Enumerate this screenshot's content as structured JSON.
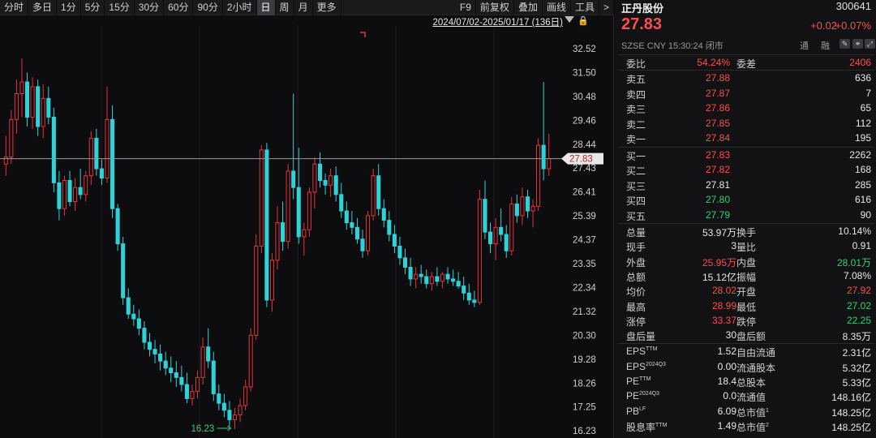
{
  "toolbar": {
    "left": [
      "分时",
      "多日",
      "1分",
      "5分",
      "15分",
      "30分",
      "60分",
      "90分",
      "2小时",
      "日",
      "周",
      "月",
      "更多"
    ],
    "active": "日",
    "right": [
      "F9",
      "前复权",
      "叠加",
      "画线",
      "工具",
      ">"
    ]
  },
  "chart": {
    "range": "2024/07/02-2025/01/17 (136日)",
    "price_labels": [
      "32.52",
      "31.50",
      "30.48",
      "29.46",
      "28.44",
      "27.43",
      "26.41",
      "25.39",
      "24.37",
      "23.35",
      "22.34",
      "21.32",
      "20.30",
      "19.28",
      "18.26",
      "17.25",
      "16.23"
    ],
    "current_price_tag": "27.83",
    "low_marker": "16.23",
    "colors": {
      "up": "#e8323c",
      "down": "#2ed3d8",
      "tag_bg": "#e8e8e8",
      "tag_fg": "#c81e28",
      "low": "#2fd17a"
    }
  },
  "chart_data": {
    "type": "candlestick",
    "ylim": [
      16.23,
      32.52
    ],
    "ohlc": [
      [
        27.6,
        28.8,
        27.1,
        27.9
      ],
      [
        27.9,
        29.9,
        27.6,
        29.5
      ],
      [
        29.5,
        31.2,
        28.9,
        30.6
      ],
      [
        30.6,
        32.1,
        29.6,
        31.1
      ],
      [
        31.1,
        31.5,
        29.2,
        29.6
      ],
      [
        29.6,
        31.3,
        29.1,
        30.9
      ],
      [
        30.9,
        31.2,
        28.8,
        29.2
      ],
      [
        29.2,
        31.0,
        28.7,
        30.4
      ],
      [
        30.4,
        30.9,
        29.3,
        29.6
      ],
      [
        29.6,
        30.0,
        26.4,
        26.8
      ],
      [
        26.8,
        27.3,
        25.2,
        25.7
      ],
      [
        25.7,
        27.1,
        25.4,
        26.9
      ],
      [
        26.9,
        27.3,
        25.8,
        26.0
      ],
      [
        26.0,
        27.0,
        25.6,
        26.6
      ],
      [
        26.6,
        27.4,
        26.1,
        26.3
      ],
      [
        26.3,
        27.3,
        26.0,
        27.1
      ],
      [
        27.1,
        29.0,
        26.7,
        28.7
      ],
      [
        28.7,
        29.1,
        27.1,
        27.4
      ],
      [
        27.4,
        27.8,
        26.7,
        27.0
      ],
      [
        27.0,
        30.9,
        26.8,
        29.5
      ],
      [
        29.5,
        30.1,
        25.3,
        25.7
      ],
      [
        25.7,
        25.9,
        23.9,
        24.2
      ],
      [
        24.2,
        24.5,
        21.6,
        21.9
      ],
      [
        21.9,
        22.3,
        21.0,
        21.2
      ],
      [
        21.2,
        21.6,
        20.7,
        21.0
      ],
      [
        21.0,
        21.4,
        20.3,
        20.6
      ],
      [
        20.6,
        20.9,
        19.7,
        20.0
      ],
      [
        20.0,
        20.4,
        19.4,
        19.7
      ],
      [
        19.7,
        20.1,
        19.1,
        19.5
      ],
      [
        19.5,
        19.9,
        18.8,
        19.2
      ],
      [
        19.2,
        19.6,
        18.6,
        18.9
      ],
      [
        18.9,
        19.4,
        18.3,
        18.7
      ],
      [
        18.7,
        19.2,
        18.1,
        18.5
      ],
      [
        18.5,
        19.0,
        17.9,
        18.2
      ],
      [
        18.2,
        18.7,
        17.4,
        17.6
      ],
      [
        17.6,
        18.2,
        17.3,
        17.9
      ],
      [
        17.9,
        18.8,
        17.6,
        18.5
      ],
      [
        18.5,
        20.2,
        18.2,
        19.8
      ],
      [
        19.8,
        20.6,
        18.9,
        19.2
      ],
      [
        19.2,
        19.6,
        17.5,
        17.8
      ],
      [
        17.8,
        18.2,
        17.1,
        17.4
      ],
      [
        17.4,
        17.8,
        16.8,
        17.1
      ],
      [
        17.1,
        17.5,
        16.4,
        16.7
      ],
      [
        16.7,
        17.2,
        16.3,
        16.9
      ],
      [
        16.9,
        17.6,
        16.6,
        17.3
      ],
      [
        17.3,
        18.4,
        17.1,
        18.1
      ],
      [
        18.1,
        20.6,
        17.9,
        20.3
      ],
      [
        20.3,
        24.6,
        20.1,
        24.1
      ],
      [
        24.1,
        28.4,
        23.8,
        28.2
      ],
      [
        28.2,
        28.5,
        21.5,
        21.8
      ],
      [
        21.8,
        23.8,
        21.3,
        23.5
      ],
      [
        23.5,
        25.8,
        23.1,
        25.1
      ],
      [
        25.1,
        26.0,
        23.9,
        24.3
      ],
      [
        24.3,
        27.6,
        24.0,
        27.3
      ],
      [
        27.3,
        30.6,
        26.1,
        26.6
      ],
      [
        26.6,
        28.3,
        24.2,
        24.5
      ],
      [
        24.5,
        25.1,
        23.7,
        24.8
      ],
      [
        24.8,
        26.6,
        24.5,
        26.4
      ],
      [
        26.4,
        27.9,
        25.7,
        27.6
      ],
      [
        27.6,
        28.1,
        26.6,
        26.9
      ],
      [
        26.9,
        27.2,
        26.3,
        26.7
      ],
      [
        26.7,
        27.4,
        26.2,
        27.1
      ],
      [
        27.1,
        27.5,
        26.0,
        26.3
      ],
      [
        26.3,
        26.8,
        25.3,
        25.6
      ],
      [
        25.6,
        26.0,
        24.8,
        25.1
      ],
      [
        25.1,
        25.6,
        24.6,
        24.9
      ],
      [
        24.9,
        25.3,
        24.2,
        24.4
      ],
      [
        24.4,
        24.8,
        23.6,
        23.9
      ],
      [
        23.9,
        25.6,
        23.7,
        25.4
      ],
      [
        25.4,
        27.4,
        25.2,
        27.1
      ],
      [
        27.1,
        27.6,
        25.4,
        25.7
      ],
      [
        25.7,
        26.1,
        24.9,
        25.2
      ],
      [
        25.2,
        25.6,
        24.3,
        24.6
      ],
      [
        24.6,
        25.0,
        23.8,
        24.1
      ],
      [
        24.1,
        24.5,
        23.3,
        23.6
      ],
      [
        23.6,
        24.0,
        22.9,
        23.2
      ],
      [
        23.2,
        23.6,
        22.4,
        22.7
      ],
      [
        22.7,
        23.2,
        22.3,
        22.9
      ],
      [
        22.9,
        23.3,
        22.5,
        22.8
      ],
      [
        22.8,
        23.1,
        22.3,
        22.5
      ],
      [
        22.5,
        23.0,
        22.2,
        22.8
      ],
      [
        22.8,
        23.2,
        22.4,
        22.6
      ],
      [
        22.6,
        23.0,
        22.3,
        22.9
      ],
      [
        22.9,
        23.2,
        22.5,
        22.7
      ],
      [
        22.7,
        23.1,
        22.4,
        22.6
      ],
      [
        22.6,
        23.0,
        22.3,
        22.4
      ],
      [
        22.4,
        22.8,
        21.8,
        22.1
      ],
      [
        22.1,
        22.5,
        21.6,
        21.8
      ],
      [
        21.8,
        22.2,
        21.5,
        21.7
      ],
      [
        21.7,
        26.5,
        21.6,
        26.1
      ],
      [
        26.1,
        26.9,
        24.4,
        24.7
      ],
      [
        24.7,
        25.1,
        23.8,
        24.2
      ],
      [
        24.2,
        25.3,
        23.5,
        24.9
      ],
      [
        24.9,
        25.7,
        24.3,
        24.6
      ],
      [
        24.6,
        25.0,
        23.6,
        23.9
      ],
      [
        23.9,
        26.2,
        23.7,
        25.9
      ],
      [
        25.9,
        26.3,
        25.1,
        25.4
      ],
      [
        25.4,
        26.6,
        25.0,
        26.2
      ],
      [
        26.2,
        26.5,
        25.3,
        25.6
      ],
      [
        25.6,
        26.1,
        24.9,
        25.8
      ],
      [
        25.8,
        28.7,
        25.6,
        28.4
      ],
      [
        28.4,
        31.1,
        26.9,
        27.4
      ],
      [
        27.4,
        28.9,
        27.1,
        27.83
      ]
    ]
  },
  "panel": {
    "name": "正丹股份",
    "code": "300641",
    "price": "27.83",
    "change": "+0.02",
    "change_pct": "+0.07%",
    "meta": "SZSE  CNY  15:30:24  闭市",
    "tong": "通",
    "rong": "融",
    "weibi": {
      "label": "委比",
      "value": "54.24%",
      "label2": "委差",
      "value2": "2406"
    },
    "asks": [
      {
        "label": "卖五",
        "price": "27.88",
        "vol": "636"
      },
      {
        "label": "卖四",
        "price": "27.87",
        "vol": "7"
      },
      {
        "label": "卖三",
        "price": "27.86",
        "vol": "65"
      },
      {
        "label": "卖二",
        "price": "27.85",
        "vol": "112"
      },
      {
        "label": "卖一",
        "price": "27.84",
        "vol": "195"
      }
    ],
    "bids": [
      {
        "label": "买一",
        "price": "27.83",
        "vol": "2262",
        "color": "red"
      },
      {
        "label": "买二",
        "price": "27.82",
        "vol": "168",
        "color": "red"
      },
      {
        "label": "买三",
        "price": "27.81",
        "vol": "285",
        "color": "white"
      },
      {
        "label": "买四",
        "price": "27.80",
        "vol": "616",
        "color": "green"
      },
      {
        "label": "买五",
        "price": "27.79",
        "vol": "90",
        "color": "green"
      }
    ],
    "stats": [
      {
        "l1": "总量",
        "v1": "53.97万",
        "c1": "white",
        "l2": "换手",
        "v2": "10.14%",
        "c2": "white"
      },
      {
        "l1": "现手",
        "v1": "3",
        "c1": "white",
        "l2": "量比",
        "v2": "0.91",
        "c2": "white"
      },
      {
        "l1": "外盘",
        "v1": "25.95万",
        "c1": "red",
        "l2": "内盘",
        "v2": "28.01万",
        "c2": "green"
      },
      {
        "l1": "总额",
        "v1": "15.12亿",
        "c1": "white",
        "l2": "振幅",
        "v2": "7.08%",
        "c2": "white"
      },
      {
        "l1": "均价",
        "v1": "28.02",
        "c1": "red",
        "l2": "开盘",
        "v2": "27.92",
        "c2": "red"
      },
      {
        "l1": "最高",
        "v1": "28.99",
        "c1": "red",
        "l2": "最低",
        "v2": "27.02",
        "c2": "green"
      },
      {
        "l1": "涨停",
        "v1": "33.37",
        "c1": "red",
        "l2": "跌停",
        "v2": "22.25",
        "c2": "green"
      },
      {
        "l1": "盘后量",
        "v1": "30",
        "c1": "white",
        "l2": "盘后额",
        "v2": "8.35万",
        "c2": "white"
      }
    ],
    "fund": [
      {
        "l1": "EPS",
        "s1": "TTM",
        "v1": "1.52",
        "l2": "自由流通",
        "s2": "",
        "v2": "2.31亿"
      },
      {
        "l1": "EPS",
        "s1": "2024Q3",
        "v1": "0.00",
        "l2": "流通股本",
        "s2": "",
        "v2": "5.32亿"
      },
      {
        "l1": "PE",
        "s1": "TTM",
        "v1": "18.4",
        "l2": "总股本",
        "s2": "",
        "v2": "5.33亿"
      },
      {
        "l1": "PE",
        "s1": "2024Q3",
        "v1": "0.0",
        "l2": "流通值",
        "s2": "",
        "v2": "148.16亿"
      },
      {
        "l1": "PB",
        "s1": "LF",
        "v1": "6.09",
        "l2": "总市值",
        "s2": "1",
        "v2": "148.25亿"
      },
      {
        "l1": "股息率",
        "s1": "TTM",
        "v1": "1.49",
        "l2": "总市值",
        "s2": "2",
        "v2": "148.25亿"
      }
    ]
  }
}
